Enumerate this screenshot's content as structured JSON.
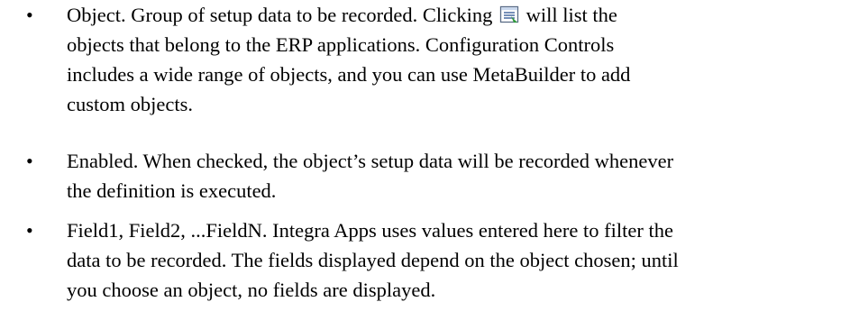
{
  "bullet_char": "•",
  "items": [
    {
      "lines": [
        {
          "before_icon": "Object. Group of setup data to be recorded. Clicking ",
          "icon": "list-lookup-icon",
          "after_icon": " will list the"
        },
        {
          "text": "objects that belong to the ERP applications. Configuration Controls"
        },
        {
          "text": "includes a wide range of objects, and you can use MetaBuilder to add"
        },
        {
          "text": "custom objects."
        }
      ]
    },
    {
      "lines": [
        {
          "text": "Enabled. When checked, the object’s setup data will be recorded whenever"
        },
        {
          "text": "the definition is executed."
        }
      ]
    },
    {
      "lines": [
        {
          "text": "Field1, Field2, ...FieldN. Integra Apps uses values entered here to filter the"
        },
        {
          "text": "data to be recorded. The fields displayed depend on the object chosen; until"
        },
        {
          "text": "you choose an object, no fields are displayed."
        }
      ]
    }
  ]
}
